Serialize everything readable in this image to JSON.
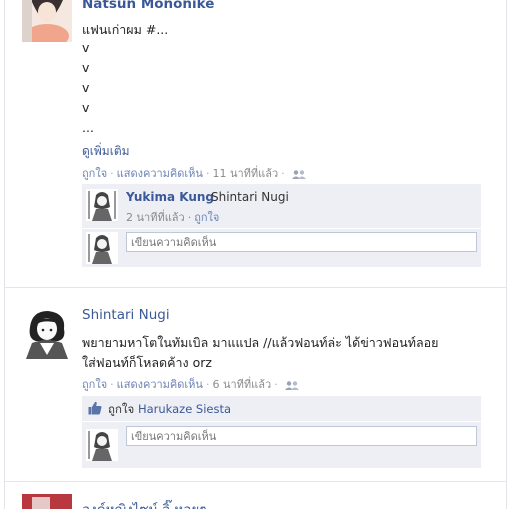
{
  "post1": {
    "author": "Natsun Mononike",
    "lines": [
      "แฟนเก่าผม #...",
      "v",
      "v",
      "v",
      "v",
      "..."
    ],
    "see_more": "ดูเพิ่มเติม",
    "like": "ถูกใจ",
    "comment": "แสดงความคิดเห็น",
    "time": "11 นาทีที่แล้ว",
    "reply": {
      "name": "Yukima Kung",
      "text": "Shintari Nugi",
      "time": "2 นาทีที่แล้ว",
      "like": "ถูกใจ"
    },
    "comment_placeholder": "เขียนความคิดเห็น"
  },
  "post2": {
    "author": "Shintari Nugi",
    "lines": [
      "พยายามหาโตในทัมเบิล มาแแปล //แล้วฟอนท์ล่ะ ได้ข่าวฟอนท์ลอย",
      "ใส่ฟอนท์ก็โหลดค้าง orz"
    ],
    "like": "ถูกใจ",
    "comment": "แสดงความคิดเห็น",
    "time": "6 นาทีที่แล้ว",
    "liked_by_prefix": "ถูกใจ",
    "liked_by": "Harukaze Siesta",
    "comment_placeholder": "เขียนความคิดเห็น"
  },
  "post3": {
    "author_partial": "องค์หญิงไซน์ จิ๊ หอยๆ"
  },
  "icons": {
    "people": "people-icon",
    "thumb": "thumbs-up-icon"
  },
  "colors": {
    "link": "#3b5998",
    "muted": "#8a8a8a",
    "comment_bg": "#edeff4"
  }
}
